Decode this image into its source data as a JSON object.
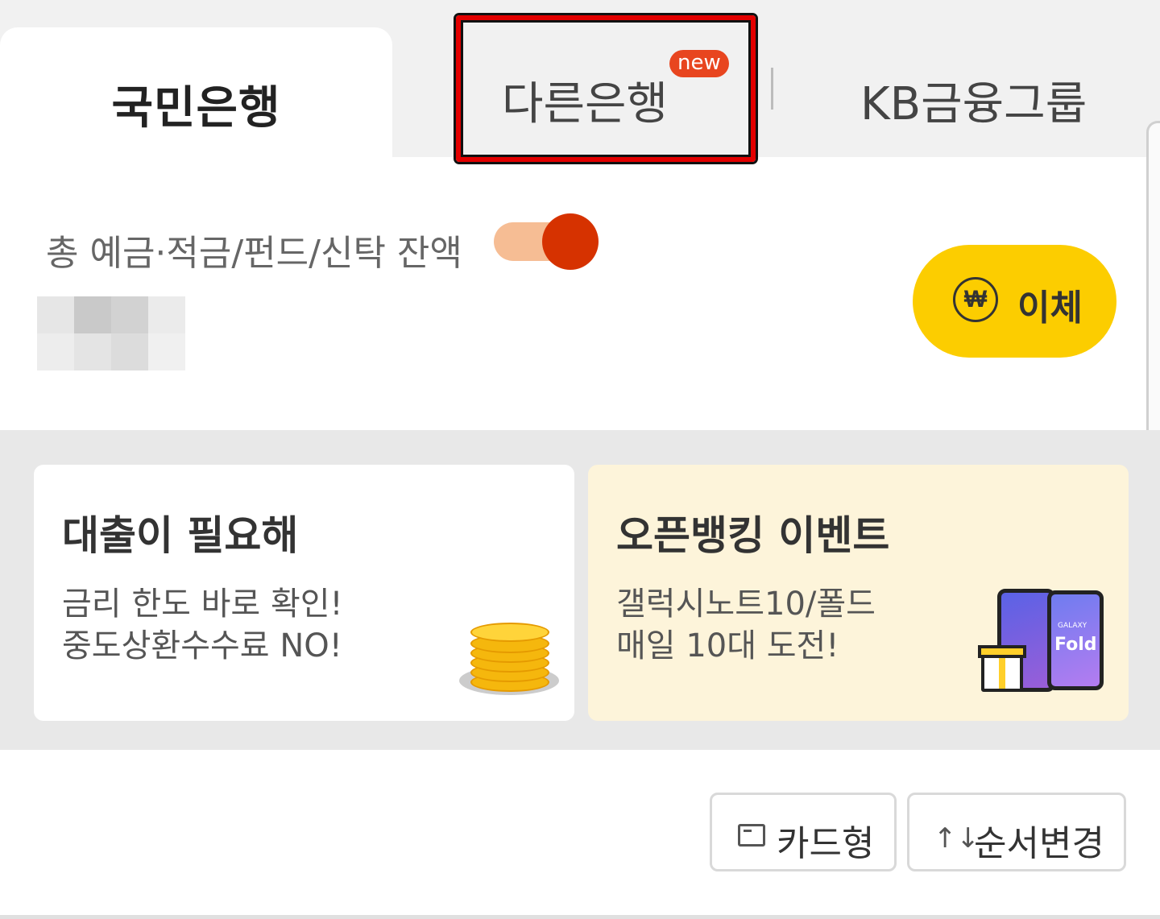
{
  "tabs": [
    {
      "label": "국민은행",
      "active": true
    },
    {
      "label": "다른은행",
      "badge": "new"
    },
    {
      "label": "KB금융그룹"
    }
  ],
  "balance": {
    "label": "총 예금·적금/펀드/신탁 잔액",
    "toggle_on": true,
    "toggle_color": "#d63200"
  },
  "transfer": {
    "label": "이체",
    "icon": "won-icon",
    "color": "#fccd00"
  },
  "promos": [
    {
      "title": "대출이 필요해",
      "line1": "금리 한도 바로 확인!",
      "line2": "중도상환수수료 NO!",
      "image": "coin-stack-icon"
    },
    {
      "title": "오픈뱅킹 이벤트",
      "line1": "갤럭시노트10/폴드",
      "line2": "매일 10대 도전!",
      "image": "galaxy-fold-gift-icon",
      "phone_text": "Fold",
      "phone_brand": "GALAXY"
    }
  ],
  "buttons": {
    "card_view": "카드형",
    "reorder": "순서변경",
    "reorder_icon": "↑↓"
  },
  "highlight_color": "#e30000"
}
